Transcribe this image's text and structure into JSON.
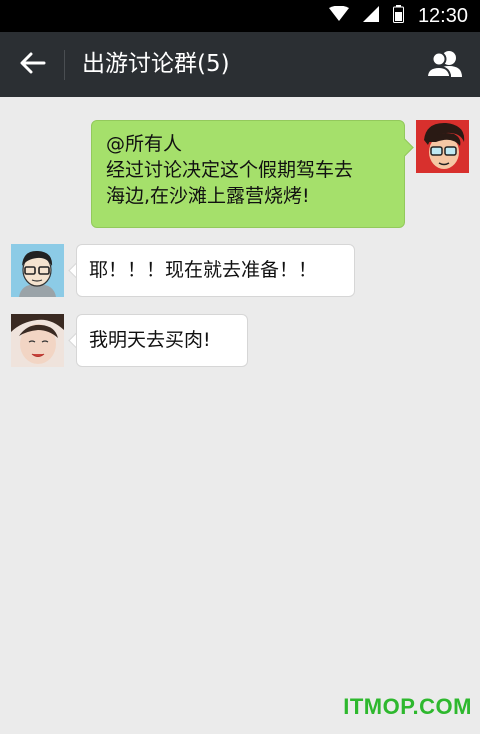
{
  "status_bar": {
    "time": "12:30",
    "icons": [
      "wifi-icon",
      "signal-icon",
      "battery-icon"
    ]
  },
  "header": {
    "title": "出游讨论群(5)",
    "back_icon": "arrow-left-icon",
    "members_icon": "group-icon"
  },
  "messages": [
    {
      "direction": "outgoing",
      "lines": [
        "@所有人",
        "经过讨论决定这个假期驾车去",
        "海边,在沙滩上露营烧烤!"
      ]
    },
    {
      "direction": "incoming",
      "text": "耶！！！现在就去准备！！"
    },
    {
      "direction": "incoming",
      "text": "我明天去买肉!"
    }
  ],
  "watermark": "ITMOP.COM",
  "colors": {
    "header": "#2b2f33",
    "outgoing_bubble": "#a5e06b",
    "background": "#ebebeb",
    "watermark": "#2eb82e"
  }
}
